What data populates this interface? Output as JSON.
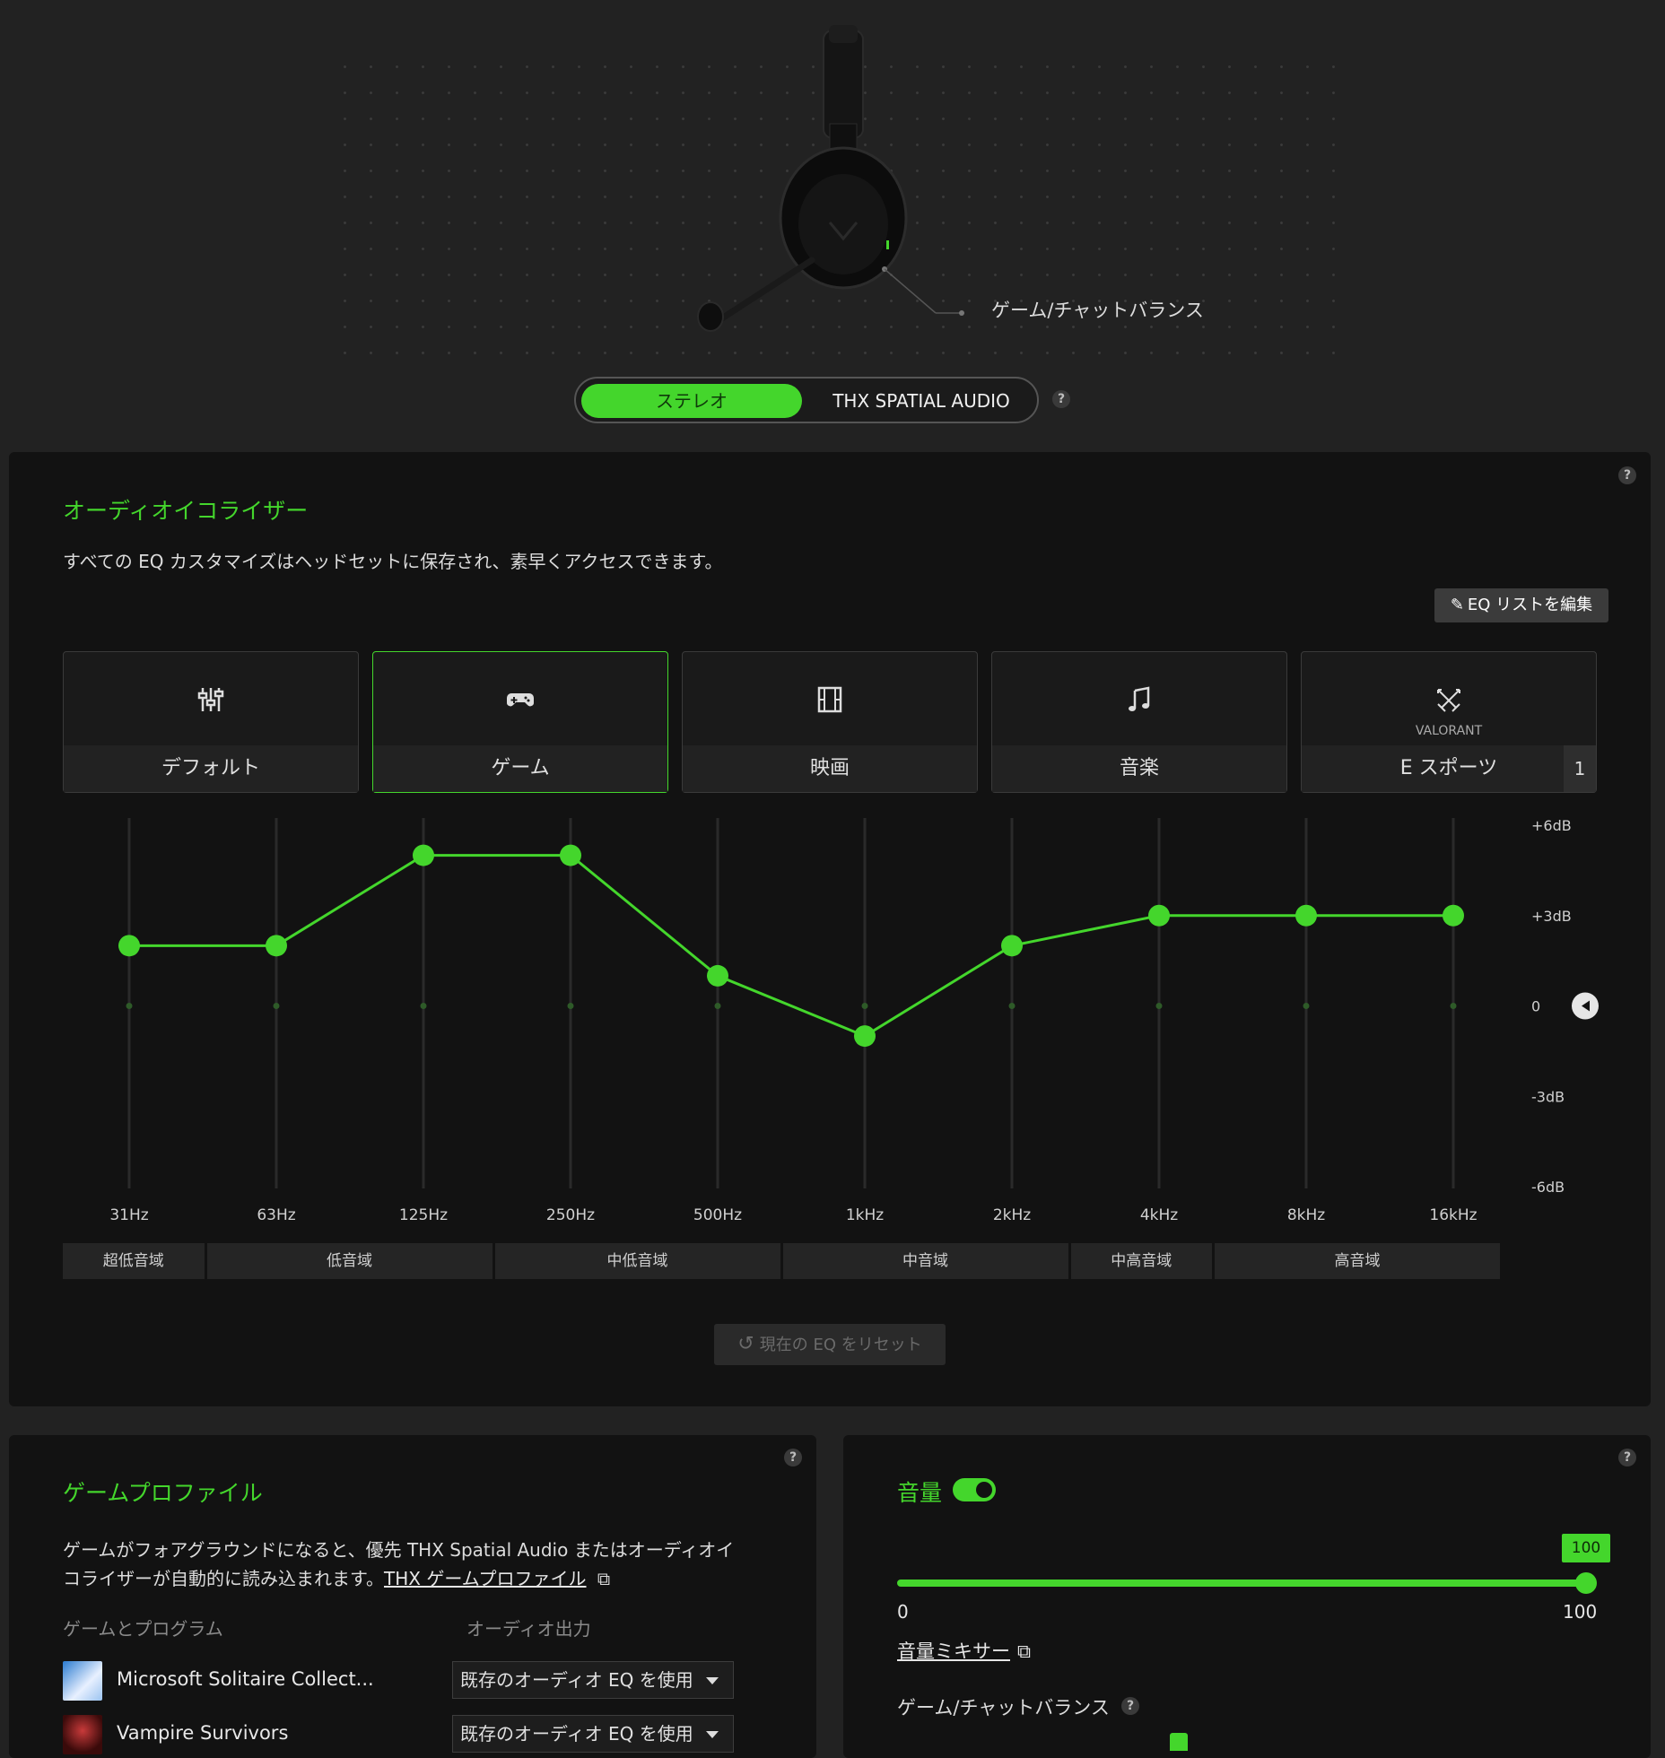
{
  "colors": {
    "accent": "#44d62c",
    "panel": "#121212",
    "background": "#222222"
  },
  "headset": {
    "balance_label": "ゲーム/チャットバランス"
  },
  "mode_toggle": {
    "options": [
      "ステレオ",
      "THX SPATIAL AUDIO"
    ],
    "selected": "ステレオ",
    "help": "?"
  },
  "equalizer": {
    "title": "オーディオイコライザー",
    "description": "すべての EQ カスタマイズはヘッドセットに保存され、素早くアクセスできます。",
    "edit_button": "EQ リストを編集",
    "help": "?",
    "presets": [
      {
        "label": "デフォルト",
        "icon": "sliders-icon",
        "selected": false
      },
      {
        "label": "ゲーム",
        "icon": "gamepad-icon",
        "selected": true
      },
      {
        "label": "映画",
        "icon": "film-icon",
        "selected": false
      },
      {
        "label": "音楽",
        "icon": "music-note-icon",
        "selected": false
      },
      {
        "label": "E スポーツ",
        "icon": "valorant-icon",
        "sublabel": "VALORANT",
        "badge": "1",
        "selected": false
      }
    ],
    "db_labels": [
      "+6dB",
      "+3dB",
      "0",
      "-3dB",
      "-6dB"
    ],
    "frequencies": [
      "31Hz",
      "63Hz",
      "125Hz",
      "250Hz",
      "500Hz",
      "1kHz",
      "2kHz",
      "4kHz",
      "8kHz",
      "16kHz"
    ],
    "gains_db": [
      2,
      2,
      5,
      5,
      1,
      -1,
      2,
      3,
      3,
      3
    ],
    "bands": [
      "超低音域",
      "低音域",
      "中低音域",
      "中音域",
      "中高音域",
      "高音域"
    ],
    "reset_button": "現在の EQ をリセット"
  },
  "game_profile": {
    "title": "ゲームプロファイル",
    "help": "?",
    "description_line1": "ゲームがフォアグラウンドになると、優先 THX Spatial Audio またはオーディオイ",
    "description_line2": "コライザーが自動的に読み込まれます。",
    "link": "THX ゲームプロファイル",
    "col_game": "ゲームとプログラム",
    "col_output": "オーディオ出力",
    "apps": [
      {
        "name": "Microsoft Solitaire Collect...",
        "output": "既存のオーディオ EQ を使用"
      },
      {
        "name": "Vampire Survivors",
        "output": "既存のオーディオ EQ を使用"
      }
    ]
  },
  "volume": {
    "title": "音量",
    "help": "?",
    "enabled": true,
    "value": "100",
    "min": "0",
    "max": "100",
    "mixer_link": "音量ミキサー",
    "balance_label": "ゲーム/チャットバランス",
    "balance_help": "?"
  }
}
